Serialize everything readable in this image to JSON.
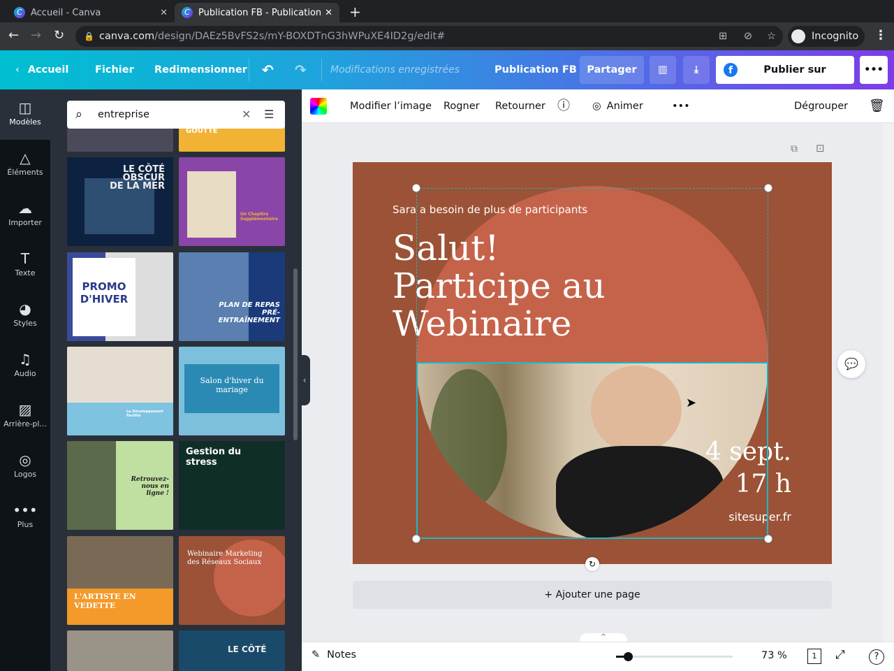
{
  "browser": {
    "tabs": [
      {
        "title": "Accueil - Canva"
      },
      {
        "title": "Publication FB - Publication"
      }
    ],
    "url_host": "canva.com",
    "url_path": "/design/DAEz5BvFS2s/mY-BOXDTnG3hWPuXE4ID2g/edit#",
    "profile": "Incognito"
  },
  "header": {
    "back": "Accueil",
    "file": "Fichier",
    "resize": "Redimensionner",
    "status": "Modifications enregistrées",
    "doc_title": "Publication FB",
    "share": "Partager",
    "publish": "Publier sur Facebook"
  },
  "sidebar": {
    "items": [
      {
        "label": "Modèles"
      },
      {
        "label": "Éléments"
      },
      {
        "label": "Importer"
      },
      {
        "label": "Texte"
      },
      {
        "label": "Styles"
      },
      {
        "label": "Audio"
      },
      {
        "label": "Arrière-pl..."
      },
      {
        "label": "Logos"
      },
      {
        "label": "Plus"
      }
    ]
  },
  "search": {
    "value": "entreprise"
  },
  "templates": [
    {
      "title": "GOUTTE"
    },
    {
      "title": "LE CÔTÉ OBSCUR DE LA MER"
    },
    {
      "title": "Un Chapitre Supplémentaire"
    },
    {
      "title": "PROMO D'HIVER"
    },
    {
      "title": "PLAN DE REPAS PRÉ-ENTRAÎNEMENT"
    },
    {
      "title": "Le Développement Facilité"
    },
    {
      "title": "Salon d'hiver du mariage"
    },
    {
      "title": "Retrouvez-nous en ligne !"
    },
    {
      "title": "Gestion du stress"
    },
    {
      "title": "L'ARTISTE EN VEDETTE"
    },
    {
      "title": "Webinaire Marketing des Réseaux Sociaux"
    },
    {
      "title": ""
    },
    {
      "title": "LE CÔTÉ"
    }
  ],
  "toolbar": {
    "edit_image": "Modifier l’image",
    "crop": "Rogner",
    "flip": "Retourner",
    "animate": "Animer",
    "ungroup": "Dégrouper"
  },
  "design": {
    "subtitle": "Sara a besoin de plus de participants",
    "title_lines": [
      "Salut!",
      "Participe au",
      "Webinaire"
    ],
    "date": "4 sept.",
    "time": "17 h",
    "site": "sitesuper.fr",
    "bg": "#9b5236",
    "circle": "#c5634a"
  },
  "add_page": "+ Ajouter une page",
  "bottom": {
    "notes": "Notes",
    "zoom": "73 %",
    "page": "1",
    "zoom_fraction": 0.1
  }
}
